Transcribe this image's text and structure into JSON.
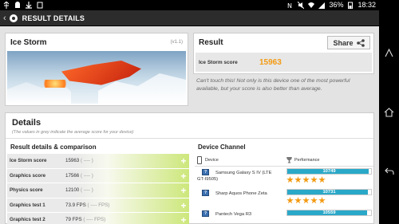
{
  "status_bar": {
    "left_icons": [
      "usb-icon",
      "android-debug-icon",
      "download-icon",
      "app-icon"
    ],
    "right_icons": [
      "nfc-icon",
      "mute-icon",
      "wifi-icon",
      "signal-icon"
    ],
    "battery": "36%",
    "time": "18:32"
  },
  "action_bar": {
    "title": "RESULT DETAILS"
  },
  "test_panel": {
    "name": "Ice Storm",
    "version": "(v1.1)"
  },
  "result": {
    "title": "Result",
    "share_label": "Share",
    "score_label": "Ice Storm score",
    "score_value": "15963",
    "message": "Can't touch this! Not only is this device one of the most powerful available, but your score is also better than average."
  },
  "details": {
    "title": "Details",
    "subtitle": "(The values in grey indicate the average score for your device)",
    "comparison_header": "Result details & comparison",
    "rows": [
      {
        "label": "Ice Storm score",
        "value": "15963",
        "avg": "( ---- )"
      },
      {
        "label": "Graphics score",
        "value": "17566",
        "avg": "( ---- )"
      },
      {
        "label": "Physics score",
        "value": "12100",
        "avg": "( ---- )"
      },
      {
        "label": "Graphics test 1",
        "value": "73.9 FPS",
        "avg": "( ---- FPS)"
      },
      {
        "label": "Graphics test 2",
        "value": "79 FPS",
        "avg": "( ---- FPS)"
      }
    ]
  },
  "device_channel": {
    "header": "Device Channel",
    "col_device": "Device",
    "col_performance": "Performance",
    "devices": [
      {
        "name": "Samsung Galaxy S IV (LTE",
        "name2": "GT-I9505)",
        "score": "10749",
        "fill": 0.97,
        "stars": 5
      },
      {
        "name": "Sharp Aquos Phone Zeta",
        "name2": "",
        "score": "10731",
        "fill": 0.96,
        "stars": 5
      },
      {
        "name": "Pantech Vega R3",
        "name2": "",
        "score": "10559",
        "fill": 0.95,
        "stars": 5
      }
    ]
  },
  "colors": {
    "accent": "#f39a12",
    "bar": "#2aa8c8",
    "green": "#cde77b"
  }
}
